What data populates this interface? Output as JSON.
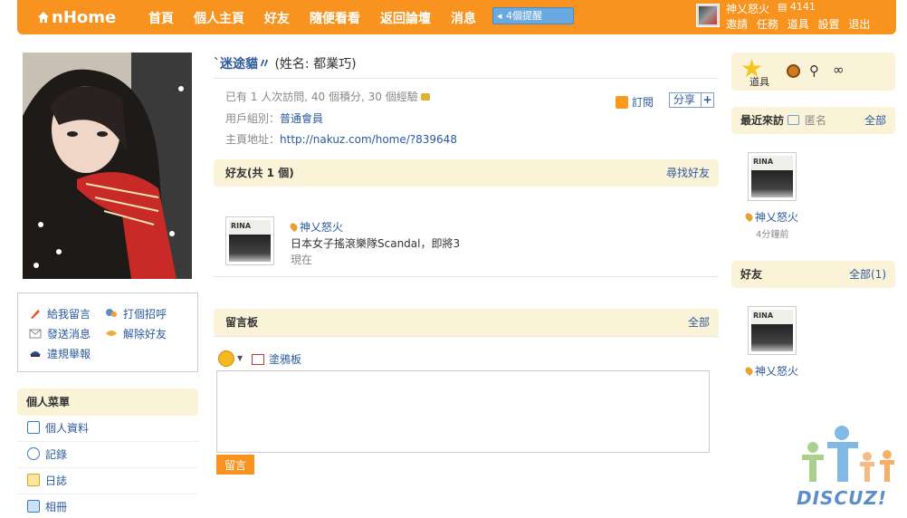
{
  "header": {
    "logo": "nHome",
    "nav": [
      "首頁",
      "個人主頁",
      "好友",
      "隨便看看",
      "返回論壇",
      "消息"
    ],
    "reminder": "4個提醒",
    "user_name": "神乂怒火",
    "credits": "4141",
    "user_links": [
      "邀請",
      "任務",
      "道具",
      "設置",
      "退出"
    ]
  },
  "left": {
    "actions": [
      "給我留言",
      "打個招呼",
      "發送消息",
      "解除好友",
      "違規舉報"
    ],
    "menu_title": "個人菜單",
    "menu_items": [
      "個人資料",
      "記錄",
      "日誌",
      "相冊"
    ]
  },
  "profile": {
    "nickname": "`迷途貓〃",
    "realname": "(姓名: 都業巧)",
    "stats": "已有 1 人次訪問, 40 個積分, 30 個經驗",
    "group_label": "用戶組別：",
    "group": "普通會員",
    "url_label": "主頁地址：",
    "url": "http://nakuz.com/home/?839648",
    "subscribe": "訂閱",
    "share": "分享",
    "share_plus": "+"
  },
  "friends": {
    "title": "好友(共 1 個)",
    "find": "尋找好友",
    "items": [
      {
        "name": "神乂怒火",
        "status": "日本女子搖滾樂隊Scandal，即將3",
        "time": "現在"
      }
    ]
  },
  "guestbook": {
    "title": "留言板",
    "all": "全部",
    "graffiti": "塗鴉板",
    "submit": "留言"
  },
  "right": {
    "tools_label": "道具",
    "recent_title": "最近來訪",
    "anon": "匿名",
    "recent_all": "全部",
    "recent_name": "神乂怒火",
    "recent_time": "4分鐘前",
    "friends_title": "好友",
    "friends_all": "全部(1)",
    "friend_name": "神乂怒火"
  },
  "watermark": "DISCUZ!"
}
